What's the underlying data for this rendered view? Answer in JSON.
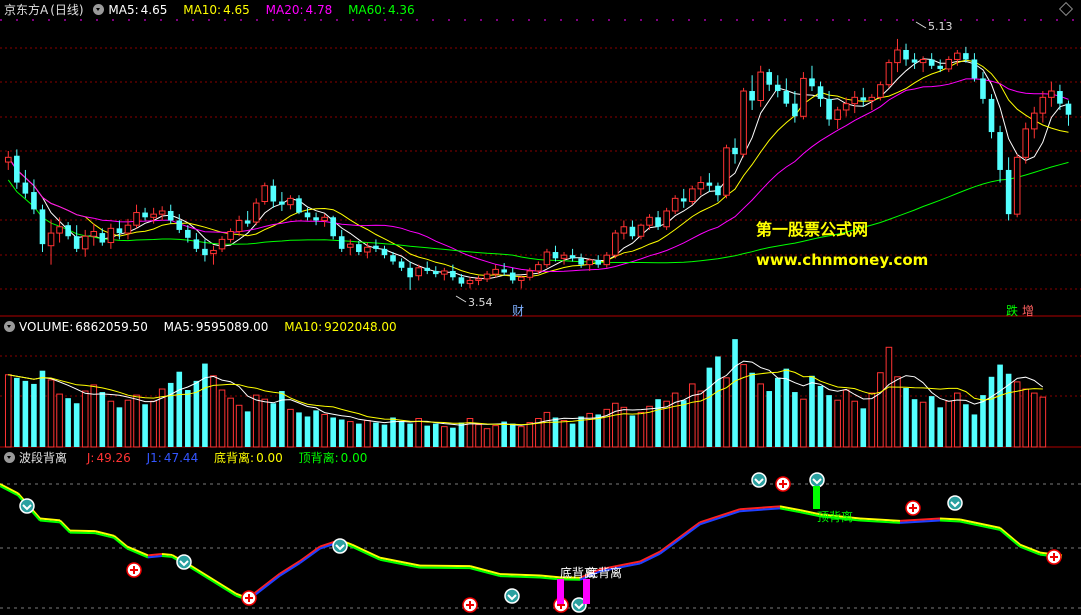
{
  "header": {
    "stock_name": "京东方A",
    "period": "(日线)",
    "ma5_label": "MA5:",
    "ma5_value": "4.65",
    "ma10_label": "MA10:",
    "ma10_value": "4.65",
    "ma20_label": "MA20:",
    "ma20_value": "4.78",
    "ma60_label": "MA60:",
    "ma60_value": "4.36"
  },
  "volume_header": {
    "label": "VOLUME:",
    "value": "6862059.50",
    "ma5_label": "MA5:",
    "ma5_value": "9595089.00",
    "ma10_label": "MA10:",
    "ma10_value": "9202048.00"
  },
  "indicator_header": {
    "name": "波段背离",
    "j_label": "J:",
    "j_value": "49.26",
    "j1_label": "J1:",
    "j1_value": "47.44",
    "bottom_div_label": "底背离:",
    "bottom_div_value": "0.00",
    "top_div_label": "顶背离:",
    "top_div_value": "0.00"
  },
  "annotations": {
    "high_price": "5.13",
    "low_price": "3.54",
    "cai_marker": "财",
    "die_marker": "跌",
    "zeng_marker": "增",
    "watermark_name": "第一股票公式网",
    "watermark_url": "www.chnmoney.com",
    "bottom_divergence": "底背离",
    "top_divergence": "顶背离"
  },
  "colors": {
    "up": "#ff3333",
    "down": "#54ffff",
    "ma5": "#ffffff",
    "ma10": "#ffff00",
    "ma20": "#ff00ff",
    "ma60": "#00ff00",
    "watermark": "#ffff00",
    "grid": "#8a0000"
  },
  "chart_data": [
    {
      "type": "candlestick",
      "panel": "price",
      "ylim": [
        3.4,
        5.25
      ],
      "ohlc": [
        [
          4.35,
          4.42,
          4.3,
          4.38
        ],
        [
          4.39,
          4.43,
          4.18,
          4.22
        ],
        [
          4.22,
          4.3,
          4.12,
          4.15
        ],
        [
          4.16,
          4.24,
          4.02,
          4.05
        ],
        [
          4.05,
          4.08,
          3.78,
          3.83
        ],
        [
          3.82,
          3.98,
          3.7,
          3.9
        ],
        [
          3.9,
          4.0,
          3.84,
          3.94
        ],
        [
          3.95,
          3.97,
          3.86,
          3.88
        ],
        [
          3.88,
          3.95,
          3.78,
          3.8
        ],
        [
          3.8,
          3.92,
          3.75,
          3.88
        ],
        [
          3.88,
          3.96,
          3.82,
          3.91
        ],
        [
          3.9,
          3.93,
          3.82,
          3.84
        ],
        [
          3.84,
          3.96,
          3.8,
          3.93
        ],
        [
          3.93,
          3.98,
          3.86,
          3.9
        ],
        [
          3.9,
          3.99,
          3.86,
          3.95
        ],
        [
          3.95,
          4.08,
          3.93,
          4.03
        ],
        [
          4.03,
          4.06,
          3.98,
          4.0
        ],
        [
          4.0,
          4.06,
          3.96,
          4.02
        ],
        [
          4.02,
          4.07,
          3.98,
          4.04
        ],
        [
          4.04,
          4.08,
          3.96,
          3.98
        ],
        [
          3.98,
          4.02,
          3.9,
          3.92
        ],
        [
          3.92,
          3.95,
          3.84,
          3.87
        ],
        [
          3.86,
          3.9,
          3.78,
          3.8
        ],
        [
          3.8,
          3.86,
          3.72,
          3.76
        ],
        [
          3.77,
          3.82,
          3.7,
          3.79
        ],
        [
          3.8,
          3.88,
          3.78,
          3.86
        ],
        [
          3.86,
          3.93,
          3.84,
          3.91
        ],
        [
          3.91,
          4.01,
          3.88,
          3.98
        ],
        [
          3.98,
          4.04,
          3.94,
          3.96
        ],
        [
          3.97,
          4.12,
          3.95,
          4.09
        ],
        [
          4.1,
          4.22,
          4.08,
          4.2
        ],
        [
          4.2,
          4.24,
          4.06,
          4.1
        ],
        [
          4.1,
          4.16,
          4.04,
          4.08
        ],
        [
          4.08,
          4.14,
          4.05,
          4.12
        ],
        [
          4.12,
          4.14,
          4.02,
          4.03
        ],
        [
          4.03,
          4.06,
          3.98,
          4.0
        ],
        [
          4.0,
          4.03,
          3.95,
          3.98
        ],
        [
          3.98,
          4.02,
          3.94,
          4.0
        ],
        [
          4.0,
          4.01,
          3.86,
          3.88
        ],
        [
          3.88,
          3.92,
          3.78,
          3.8
        ],
        [
          3.81,
          3.86,
          3.76,
          3.83
        ],
        [
          3.83,
          3.85,
          3.76,
          3.78
        ],
        [
          3.78,
          3.84,
          3.74,
          3.81
        ],
        [
          3.82,
          3.86,
          3.78,
          3.8
        ],
        [
          3.8,
          3.82,
          3.74,
          3.76
        ],
        [
          3.76,
          3.78,
          3.7,
          3.72
        ],
        [
          3.72,
          3.74,
          3.66,
          3.68
        ],
        [
          3.68,
          3.72,
          3.54,
          3.62
        ],
        [
          3.63,
          3.7,
          3.6,
          3.68
        ],
        [
          3.68,
          3.72,
          3.64,
          3.66
        ],
        [
          3.66,
          3.69,
          3.62,
          3.64
        ],
        [
          3.64,
          3.68,
          3.6,
          3.66
        ],
        [
          3.66,
          3.7,
          3.6,
          3.62
        ],
        [
          3.62,
          3.64,
          3.56,
          3.58
        ],
        [
          3.58,
          3.62,
          3.55,
          3.6
        ],
        [
          3.6,
          3.63,
          3.57,
          3.61
        ],
        [
          3.61,
          3.66,
          3.59,
          3.64
        ],
        [
          3.64,
          3.7,
          3.62,
          3.67
        ],
        [
          3.67,
          3.71,
          3.63,
          3.65
        ],
        [
          3.65,
          3.68,
          3.58,
          3.6
        ],
        [
          3.6,
          3.63,
          3.55,
          3.62
        ],
        [
          3.62,
          3.68,
          3.6,
          3.66
        ],
        [
          3.66,
          3.72,
          3.64,
          3.7
        ],
        [
          3.7,
          3.8,
          3.68,
          3.78
        ],
        [
          3.78,
          3.82,
          3.72,
          3.74
        ],
        [
          3.74,
          3.78,
          3.7,
          3.76
        ],
        [
          3.76,
          3.8,
          3.72,
          3.74
        ],
        [
          3.74,
          3.77,
          3.68,
          3.7
        ],
        [
          3.7,
          3.74,
          3.66,
          3.73
        ],
        [
          3.73,
          3.76,
          3.68,
          3.7
        ],
        [
          3.7,
          3.78,
          3.68,
          3.76
        ],
        [
          3.76,
          3.92,
          3.74,
          3.9
        ],
        [
          3.9,
          3.98,
          3.86,
          3.94
        ],
        [
          3.94,
          3.98,
          3.86,
          3.88
        ],
        [
          3.88,
          3.96,
          3.86,
          3.95
        ],
        [
          3.95,
          4.02,
          3.92,
          4.0
        ],
        [
          4.0,
          4.04,
          3.92,
          3.94
        ],
        [
          3.94,
          4.06,
          3.92,
          4.04
        ],
        [
          4.04,
          4.14,
          4.02,
          4.12
        ],
        [
          4.12,
          4.18,
          4.06,
          4.1
        ],
        [
          4.1,
          4.2,
          4.08,
          4.18
        ],
        [
          4.18,
          4.26,
          4.14,
          4.22
        ],
        [
          4.22,
          4.28,
          4.16,
          4.2
        ],
        [
          4.2,
          4.22,
          4.1,
          4.14
        ],
        [
          4.14,
          4.46,
          4.12,
          4.44
        ],
        [
          4.44,
          4.5,
          4.34,
          4.4
        ],
        [
          4.4,
          4.82,
          4.38,
          4.8
        ],
        [
          4.8,
          4.9,
          4.68,
          4.74
        ],
        [
          4.74,
          4.96,
          4.7,
          4.92
        ],
        [
          4.92,
          4.94,
          4.8,
          4.84
        ],
        [
          4.84,
          4.9,
          4.76,
          4.8
        ],
        [
          4.8,
          4.88,
          4.7,
          4.72
        ],
        [
          4.72,
          4.8,
          4.6,
          4.64
        ],
        [
          4.64,
          4.92,
          4.62,
          4.88
        ],
        [
          4.88,
          4.96,
          4.8,
          4.83
        ],
        [
          4.83,
          4.86,
          4.7,
          4.75
        ],
        [
          4.75,
          4.8,
          4.58,
          4.62
        ],
        [
          4.62,
          4.7,
          4.56,
          4.68
        ],
        [
          4.68,
          4.76,
          4.64,
          4.72
        ],
        [
          4.72,
          4.8,
          4.66,
          4.76
        ],
        [
          4.76,
          4.82,
          4.7,
          4.74
        ],
        [
          4.74,
          4.78,
          4.68,
          4.76
        ],
        [
          4.76,
          4.86,
          4.74,
          4.84
        ],
        [
          4.84,
          5.0,
          4.82,
          4.98
        ],
        [
          4.98,
          5.13,
          4.92,
          5.06
        ],
        [
          5.06,
          5.1,
          4.96,
          5.0
        ],
        [
          5.0,
          5.04,
          4.94,
          4.98
        ],
        [
          4.98,
          5.02,
          4.92,
          5.0
        ],
        [
          5.0,
          5.04,
          4.94,
          4.96
        ],
        [
          4.96,
          5.0,
          4.92,
          4.94
        ],
        [
          4.94,
          5.02,
          4.92,
          5.0
        ],
        [
          5.0,
          5.06,
          4.96,
          5.04
        ],
        [
          5.04,
          5.08,
          4.98,
          5.0
        ],
        [
          5.0,
          5.04,
          4.86,
          4.88
        ],
        [
          4.88,
          4.92,
          4.72,
          4.75
        ],
        [
          4.75,
          4.78,
          4.5,
          4.54
        ],
        [
          4.54,
          4.58,
          4.22,
          4.3
        ],
        [
          4.3,
          4.38,
          3.98,
          4.02
        ],
        [
          4.02,
          4.4,
          4.0,
          4.38
        ],
        [
          4.38,
          4.6,
          4.34,
          4.56
        ],
        [
          4.56,
          4.7,
          4.5,
          4.66
        ],
        [
          4.66,
          4.8,
          4.6,
          4.76
        ],
        [
          4.76,
          4.86,
          4.7,
          4.8
        ],
        [
          4.8,
          4.84,
          4.68,
          4.72
        ],
        [
          4.72,
          4.74,
          4.58,
          4.65
        ]
      ],
      "series": [
        {
          "name": "MA5"
        },
        {
          "name": "MA10"
        },
        {
          "name": "MA20"
        },
        {
          "name": "MA60"
        }
      ]
    },
    {
      "type": "bar",
      "panel": "volume",
      "ylim": [
        0,
        23000000
      ],
      "values": [
        14.2,
        13.6,
        13.0,
        12.4,
        15.0,
        13.2,
        10.4,
        9.6,
        8.6,
        11.0,
        12.2,
        10.8,
        9.0,
        7.8,
        9.2,
        10.2,
        8.4,
        9.0,
        11.4,
        12.6,
        14.8,
        11.2,
        13.0,
        16.4,
        14.0,
        11.2,
        9.6,
        8.2,
        7.0,
        10.2,
        9.4,
        8.6,
        11.0,
        7.4,
        6.8,
        6.0,
        7.2,
        6.4,
        5.8,
        5.4,
        5.0,
        4.6,
        5.2,
        4.8,
        4.4,
        5.8,
        5.0,
        4.6,
        5.6,
        4.2,
        4.6,
        4.0,
        3.8,
        4.8,
        5.6,
        4.4,
        3.6,
        4.2,
        5.0,
        4.6,
        4.0,
        4.8,
        5.6,
        6.8,
        5.8,
        5.2,
        4.6,
        6.0,
        6.6,
        6.4,
        7.4,
        8.6,
        7.8,
        6.2,
        6.8,
        8.0,
        9.4,
        9.0,
        10.6,
        9.2,
        12.4,
        11.0,
        15.6,
        17.8,
        13.6,
        21.2,
        16.2,
        14.6,
        12.4,
        11.0,
        13.6,
        15.4,
        10.8,
        9.4,
        14.0,
        12.0,
        10.2,
        9.2,
        11.2,
        9.0,
        7.6,
        10.6,
        14.6,
        19.6,
        13.8,
        11.6,
        9.4,
        8.8,
        10.0,
        7.8,
        9.0,
        10.6,
        8.4,
        6.4,
        10.2,
        13.8,
        16.2,
        14.4,
        12.8,
        11.4,
        10.6,
        9.8
      ]
    },
    {
      "type": "line",
      "panel": "indicator",
      "ylim": [
        -5,
        105
      ],
      "series": [
        {
          "name": "J",
          "values": []
        },
        {
          "name": "J1",
          "values": []
        }
      ]
    }
  ]
}
